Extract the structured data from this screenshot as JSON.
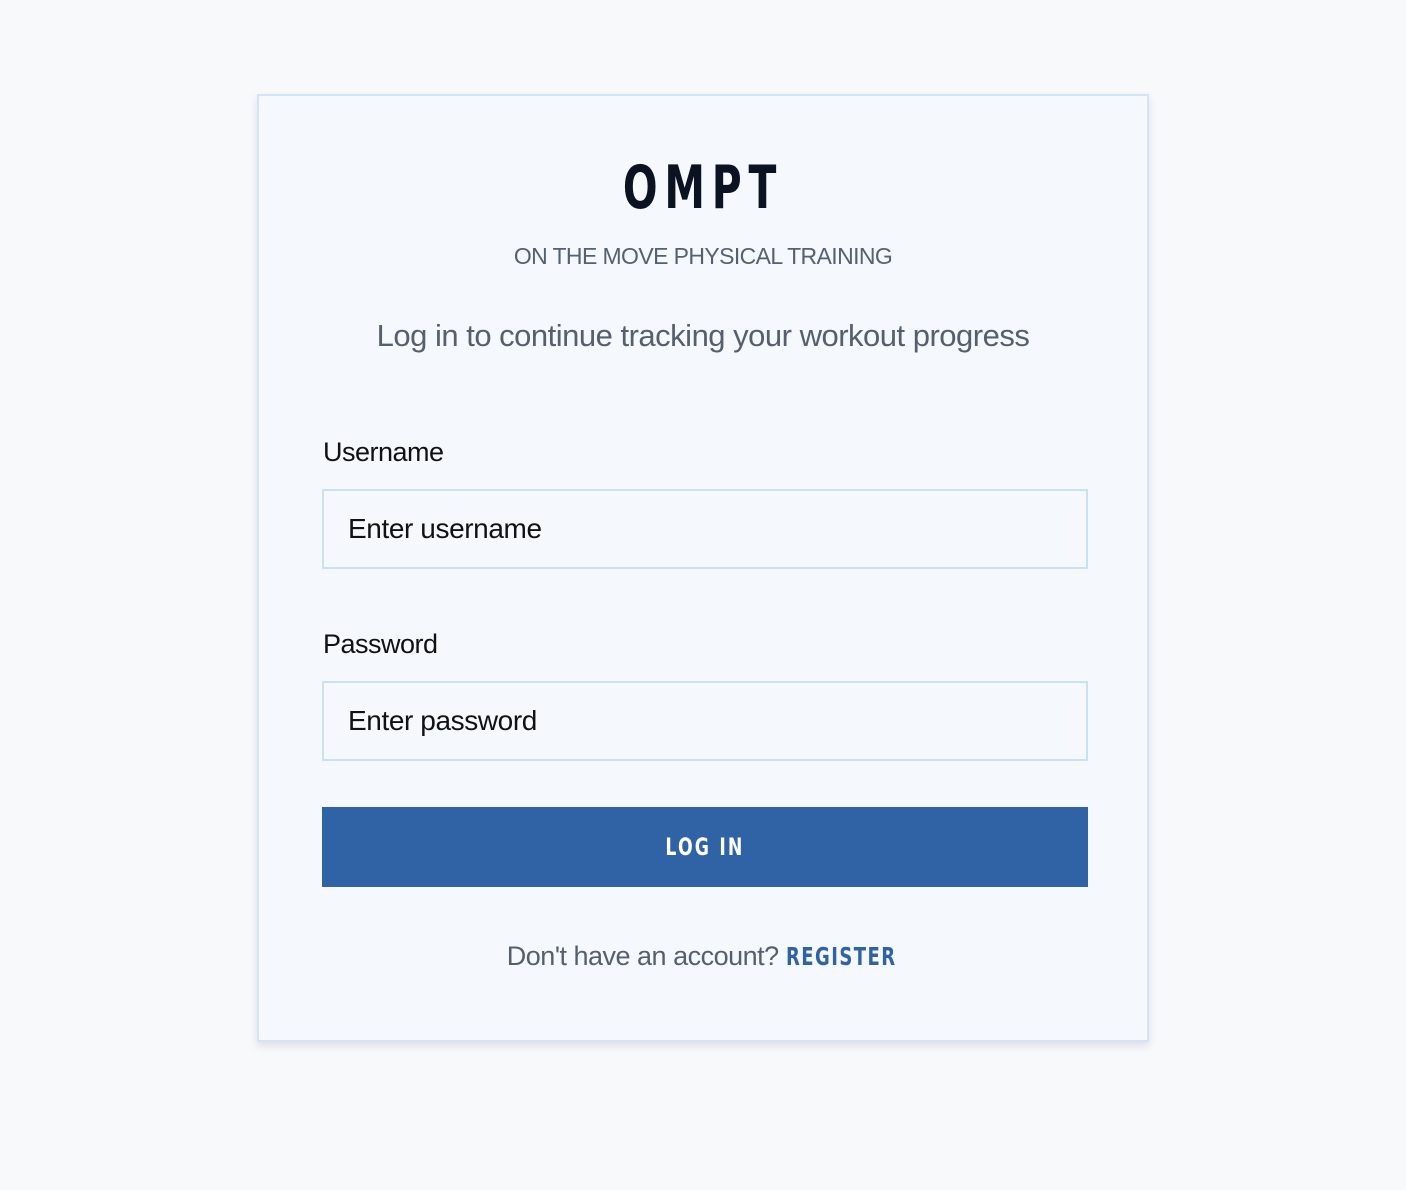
{
  "brand": {
    "logo_text": "OMPT",
    "subtitle": "ON THE MOVE PHYSICAL TRAINING"
  },
  "login": {
    "tagline": "Log in to continue tracking your workout progress",
    "username": {
      "label": "Username",
      "placeholder": "Enter username",
      "value": ""
    },
    "password": {
      "label": "Password",
      "placeholder": "Enter password",
      "value": ""
    },
    "submit_label": "LOG IN",
    "register_prompt": "Don't have an account?",
    "register_link": "REGISTER"
  },
  "colors": {
    "page_background": "#f7f9fb",
    "card_background": "#f5f8fc",
    "card_border": "#d4e4f2",
    "accent": "#3063a5",
    "logo": "#0b1222",
    "muted_text": "#555f6d"
  }
}
